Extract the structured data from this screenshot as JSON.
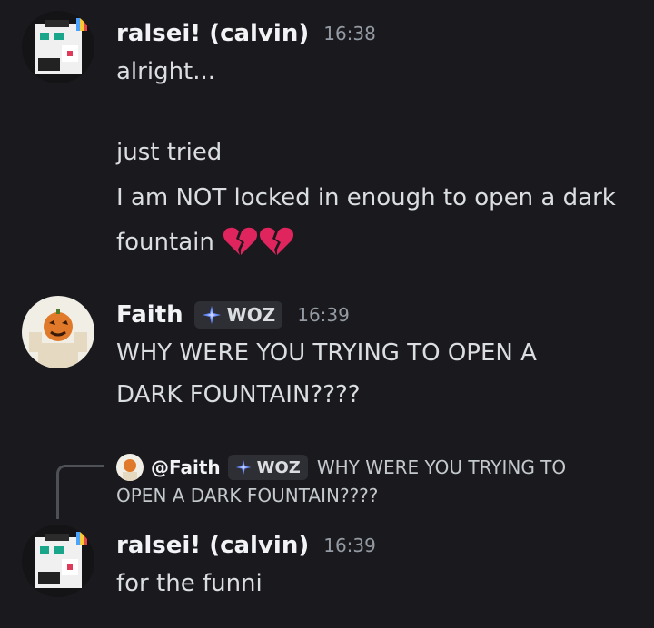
{
  "messages": [
    {
      "username": "ralsei! (calvin)",
      "timestamp": "16:38",
      "lines": [
        "alright...",
        "just tried",
        "I am NOT locked in enough to open a dark",
        "fountain"
      ],
      "emoji": "broken-heart-icon"
    },
    {
      "username": "Faith",
      "tag": "WOZ",
      "timestamp": "16:39",
      "lines": [
        "WHY WERE YOU TRYING TO OPEN A",
        "DARK FOUNTAIN????"
      ]
    },
    {
      "username": "ralsei! (calvin)",
      "timestamp": "16:39",
      "lines": [
        "for the funni"
      ],
      "reply": {
        "name": "@Faith",
        "tag": "WOZ",
        "text_line1": "WHY WERE YOU TRYING TO",
        "text_line2": "OPEN A DARK FOUNTAIN????"
      }
    }
  ],
  "colors": {
    "background": "#1a1a1e",
    "username": "#f2f3f5",
    "timestamp": "#949ba4",
    "tag_bg": "#2e2f34",
    "tag_icon": "#6b8cff",
    "broken_heart": "#e0245e"
  }
}
